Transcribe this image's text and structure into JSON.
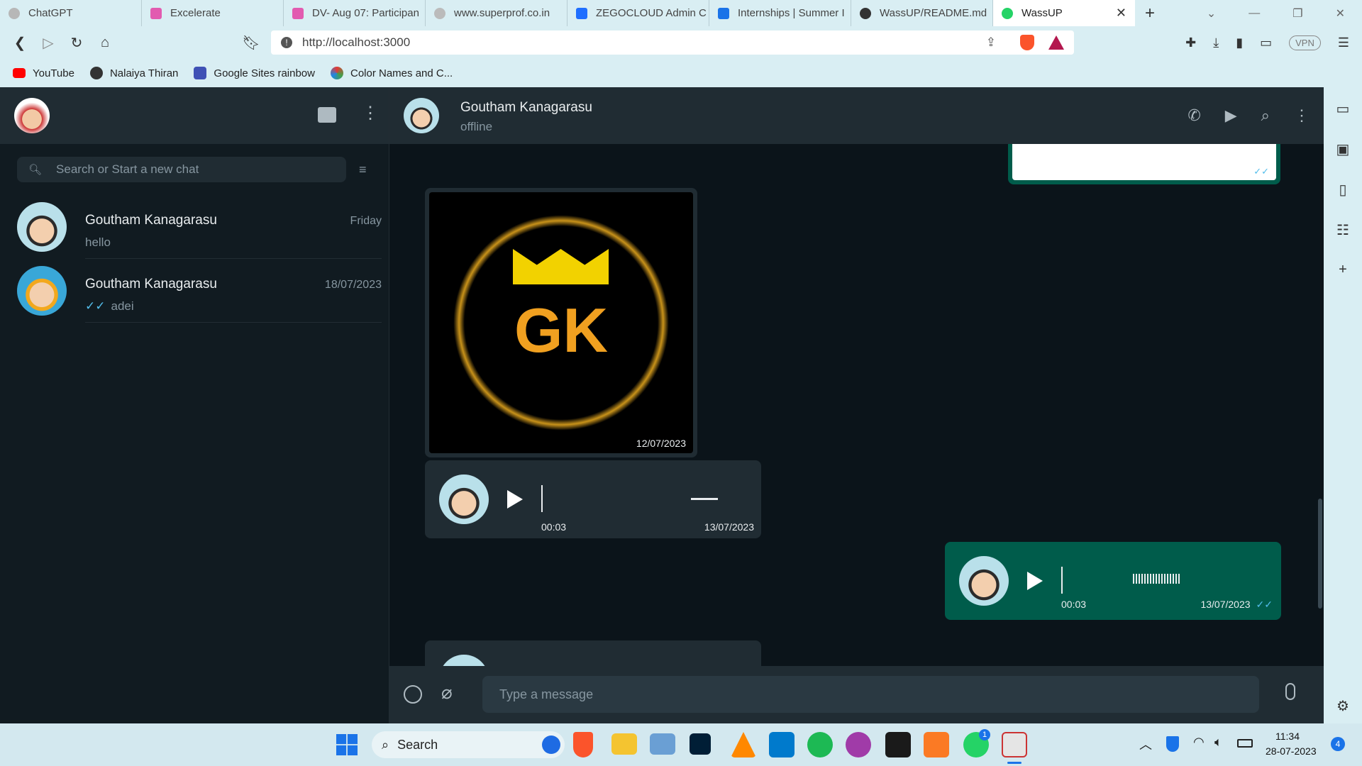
{
  "browser": {
    "tabs": [
      {
        "label": "ChatGPT",
        "color": "#888888"
      },
      {
        "label": "Excelerate",
        "color": "#e25bb0"
      },
      {
        "label": "DV- Aug 07: Participan",
        "color": "#e25bb0"
      },
      {
        "label": "www.superprof.co.in",
        "color": "#bbbbbb"
      },
      {
        "label": "ZEGOCLOUD Admin C",
        "color": "#1f6fff"
      },
      {
        "label": "Internships | Summer I",
        "color": "#1a73e8"
      },
      {
        "label": "WassUP/README.md",
        "color": "#333333"
      },
      {
        "label": "WassUP",
        "color": "#25d366"
      }
    ],
    "url": "http://localhost:3000",
    "vpn_label": "VPN",
    "bookmarks": [
      {
        "label": "YouTube",
        "color": "#ff0000"
      },
      {
        "label": "Nalaiya Thiran",
        "color": "#333333"
      },
      {
        "label": "Google Sites rainbow",
        "color": "#3f51b5"
      },
      {
        "label": "Color Names and C...",
        "color": "#222222"
      }
    ]
  },
  "sidebar": {
    "search_placeholder": "Search or Start a new chat",
    "chats": [
      {
        "name": "Goutham Kanagarasu",
        "last": "hello",
        "time": "Friday"
      },
      {
        "name": "Goutham Kanagarasu",
        "last": "adei",
        "time": "18/07/2023"
      }
    ]
  },
  "conversation": {
    "contact_name": "Goutham Kanagarasu",
    "contact_status": "offline",
    "messages": {
      "image_text": "GK",
      "image_time": "12/07/2023",
      "audio1_duration": "00:03",
      "audio1_time": "13/07/2023",
      "audio2_duration": "00:03",
      "audio2_time": "13/07/2023"
    },
    "input_placeholder": "Type a message"
  },
  "taskbar": {
    "search_label": "Search",
    "time": "11:34",
    "date": "28-07-2023",
    "notification_count": "4",
    "whatsapp_badge": "1"
  },
  "colors": {
    "app_bg": "#111b21",
    "header_bg": "#202c33",
    "outgoing_bubble": "#005c4b",
    "incoming_bubble": "#202c33",
    "accent": "#00a884"
  }
}
